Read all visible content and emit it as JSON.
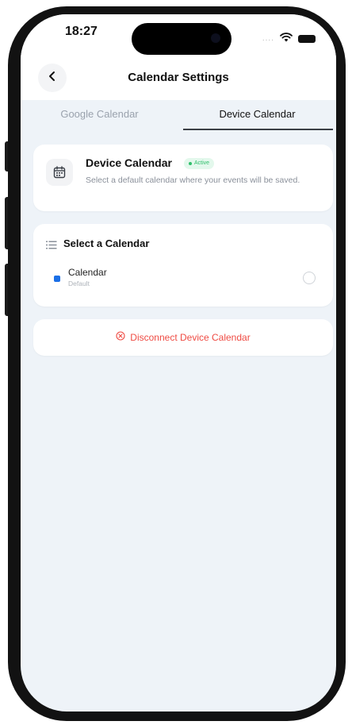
{
  "status_bar": {
    "time": "18:27",
    "signal": "....",
    "icons": [
      "wifi-icon",
      "battery-icon"
    ]
  },
  "header": {
    "title": "Calendar Settings",
    "back_icon": "chevron-left-icon"
  },
  "tabs": [
    {
      "label": "Google Calendar",
      "active": false
    },
    {
      "label": "Device Calendar",
      "active": true
    }
  ],
  "device_card": {
    "icon": "calendar-icon",
    "title": "Device Calendar",
    "badge": "Active",
    "description": "Select a default calendar where your events will be saved."
  },
  "select_card": {
    "icon": "list-icon",
    "title": "Select a Calendar",
    "calendars": [
      {
        "name": "Calendar",
        "subtitle": "Default",
        "color": "#1b6fe6",
        "selected": false
      }
    ]
  },
  "disconnect": {
    "icon": "close-circle-icon",
    "label": "Disconnect Device Calendar"
  },
  "colors": {
    "accent_green": "#2fbf6b",
    "danger_red": "#ef4b43",
    "calendar_blue": "#1b6fe6",
    "screen_bg": "#eef3f8"
  }
}
